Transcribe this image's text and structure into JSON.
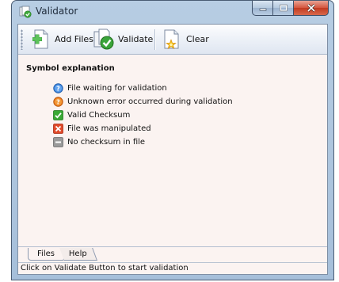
{
  "window": {
    "title": "Validator"
  },
  "toolbar": {
    "add_files_label": "Add Files",
    "validate_label": "Validate",
    "clear_label": "Clear"
  },
  "content": {
    "heading": "Symbol explanation",
    "symbols": [
      {
        "icon": "info-icon",
        "color": "#2f74d0",
        "label": "File waiting for validation"
      },
      {
        "icon": "warning-icon",
        "color": "#e8761c",
        "label": "Unknown error occurred during validation"
      },
      {
        "icon": "checkmark-icon",
        "color": "#39a935",
        "label": "Valid Checksum"
      },
      {
        "icon": "cross-icon",
        "color": "#e04a2a",
        "label": "File was manipulated"
      },
      {
        "icon": "minus-icon",
        "color": "#8c8c8c",
        "label": "No checksum in file"
      }
    ]
  },
  "tabs": [
    {
      "label": "Files",
      "active": true
    },
    {
      "label": "Help",
      "active": false
    }
  ],
  "statusbar": {
    "text": "Click on Validate Button to start validation"
  }
}
